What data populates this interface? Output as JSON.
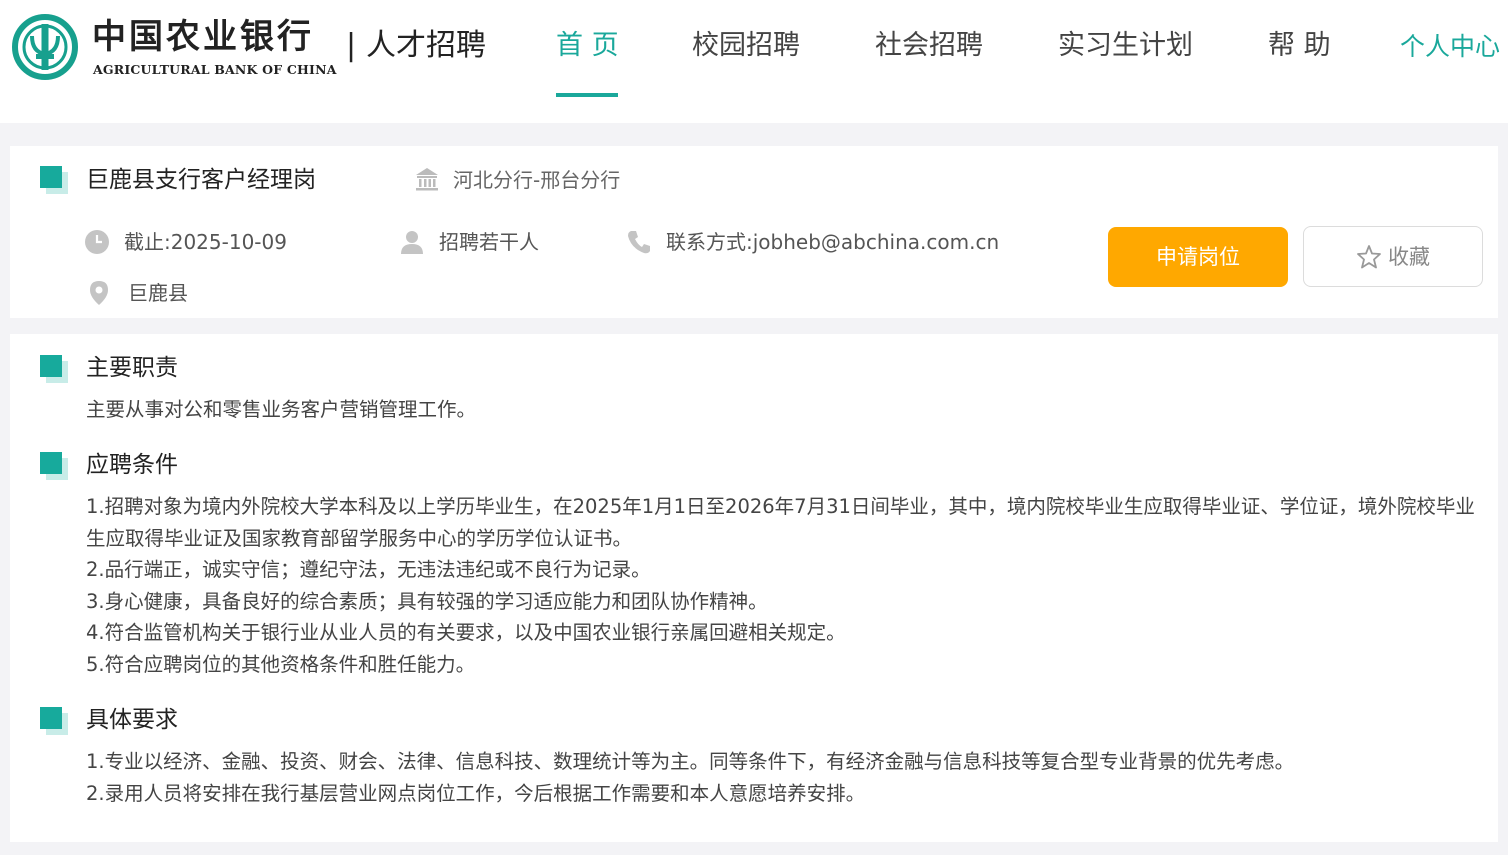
{
  "header": {
    "brand_cn": "中国农业银行",
    "brand_en": "AGRICULTURAL BANK OF CHINA",
    "separator": "|",
    "subtitle": "人才招聘",
    "logo_icon": "abc-logo-icon",
    "accent_color": "#1aa89b",
    "nav": {
      "home": "首 页",
      "campus": "校园招聘",
      "social": "社会招聘",
      "intern": "实习生计划",
      "help": "帮 助",
      "personal": "个人中心"
    },
    "active_nav": "home"
  },
  "job": {
    "title": "巨鹿县支行客户经理岗",
    "branch": "河北分行-邢台分行",
    "deadline": "截止:2025-10-09",
    "headcount": "招聘若干人",
    "contact": "联系方式:jobheb@abchina.com.cn",
    "location": "巨鹿县",
    "apply_label": "申请岗位",
    "favorite_label": "收藏",
    "apply_color": "#ffa800",
    "icons": {
      "branch": "bank-building-icon",
      "deadline": "clock-icon",
      "headcount": "person-icon",
      "contact": "phone-icon",
      "location": "location-pin-icon",
      "favorite": "star-icon"
    }
  },
  "sections": {
    "duties": {
      "title": "主要职责",
      "lines": [
        "主要从事对公和零售业务客户营销管理工作。"
      ]
    },
    "conditions": {
      "title": "应聘条件",
      "lines": [
        "1.招聘对象为境内外院校大学本科及以上学历毕业生，在2025年1月1日至2026年7月31日间毕业，其中，境内院校毕业生应取得毕业证、学位证，境外院校毕业生应取得毕业证及国家教育部留学服务中心的学历学位认证书。",
        "2.品行端正，诚实守信；遵纪守法，无违法违纪或不良行为记录。",
        "3.身心健康，具备良好的综合素质；具有较强的学习适应能力和团队协作精神。",
        "4.符合监管机构关于银行业从业人员的有关要求，以及中国农业银行亲属回避相关规定。",
        "5.符合应聘岗位的其他资格条件和胜任能力。"
      ]
    },
    "requirements": {
      "title": "具体要求",
      "lines": [
        "1.专业以经济、金融、投资、财会、法律、信息科技、数理统计等为主。同等条件下，有经济金融与信息科技等复合型专业背景的优先考虑。",
        "2.录用人员将安排在我行基层营业网点岗位工作，今后根据工作需要和本人意愿培养安排。"
      ]
    }
  }
}
